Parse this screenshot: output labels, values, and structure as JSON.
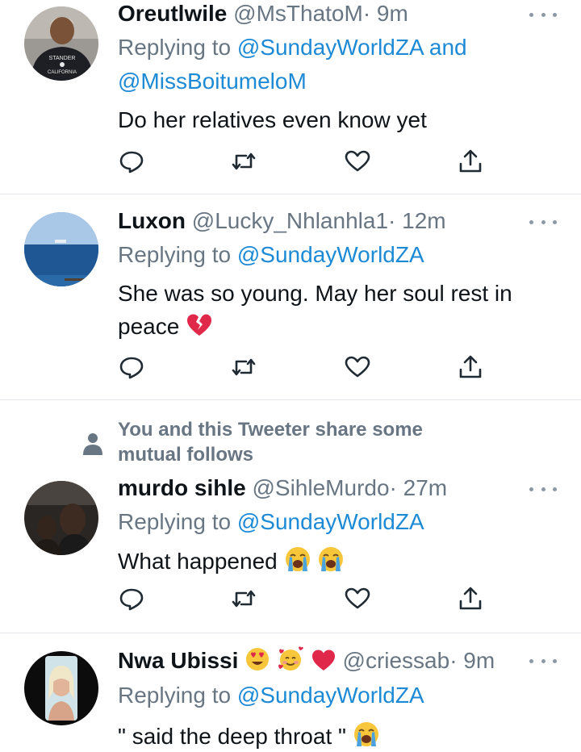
{
  "tweets": [
    {
      "name": "Oreutlwile",
      "handle": "@MsThatoM",
      "time": "· 9m",
      "reply_prefix": "Replying to",
      "reply_to_1": "@SundayWorldZA",
      "reply_and": "and",
      "reply_to_2": "@MissBoitumeloM",
      "text": "Do her relatives even know yet",
      "avatar_text_1": "STANDER",
      "avatar_text_2": "CALIFORNIA"
    },
    {
      "name": "Luxon",
      "handle": "@Lucky_Nhlanhla1",
      "time": "· 12m",
      "reply_prefix": "Replying to",
      "reply_to_1": "@SundayWorldZA",
      "text_line1": "She was so young. May her soul rest in",
      "text_line2": "peace",
      "emoji": "broken-heart"
    },
    {
      "social_context_line1": "You and this Tweeter share some",
      "social_context_line2": "mutual follows",
      "name": "murdo sihle",
      "handle": "@SihleMurdo",
      "time": "· 27m",
      "reply_prefix": "Replying to",
      "reply_to_1": "@SundayWorldZA",
      "text": "What happened",
      "emojis": [
        "loudly-crying-face",
        "loudly-crying-face"
      ]
    },
    {
      "name": "Nwa Ubissi",
      "name_emojis": [
        "smiling-face-with-heart-eyes",
        "smiling-face-with-hearts",
        "red-heart"
      ],
      "handle": "@criessab",
      "time": "· 9m",
      "reply_prefix": "Replying to",
      "reply_to_1": "@SundayWorldZA",
      "text": "\" said the deep throat \"",
      "emoji": "loudly-crying-face"
    }
  ],
  "action_icons": [
    "reply-icon",
    "retweet-icon",
    "like-icon",
    "share-icon"
  ],
  "colors": {
    "link": "#1d8ad6",
    "muted": "#687684",
    "text": "#0f1419",
    "divider": "#e3e6ea"
  }
}
